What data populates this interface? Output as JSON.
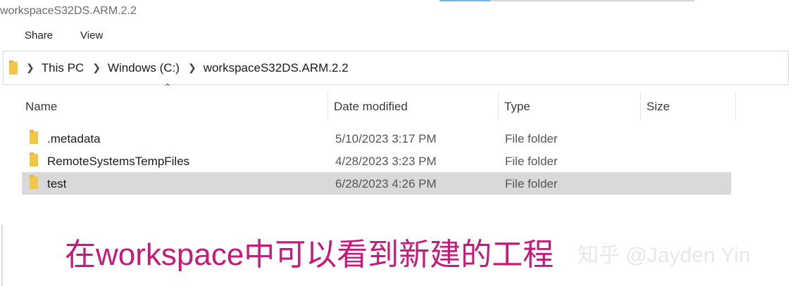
{
  "window": {
    "title": "workspaceS32DS.ARM.2.2"
  },
  "ribbon": {
    "tabs": [
      "Share",
      "View"
    ]
  },
  "address_bar": {
    "breadcrumbs": [
      "This PC",
      "Windows (C:)",
      "workspaceS32DS.ARM.2.2"
    ]
  },
  "columns": {
    "name": "Name",
    "date_modified": "Date modified",
    "type": "Type",
    "size": "Size"
  },
  "files": [
    {
      "name": ".metadata",
      "date_modified": "5/10/2023 3:17 PM",
      "type": "File folder",
      "size": "",
      "selected": false
    },
    {
      "name": "RemoteSystemsTempFiles",
      "date_modified": "4/28/2023 3:23 PM",
      "type": "File folder",
      "size": "",
      "selected": false
    },
    {
      "name": "test",
      "date_modified": "6/28/2023 4:26 PM",
      "type": "File folder",
      "size": "",
      "selected": true
    }
  ],
  "annotation": {
    "caption": "在workspace中可以看到新建的工程"
  },
  "watermark": {
    "text": "知乎 @Jayden Yin"
  },
  "icons": {
    "folder": "folder-icon",
    "breadcrumb_separator": "chevron-right-icon",
    "sort": "sort-up-icon"
  },
  "colors": {
    "folder": "#f3c64a",
    "selection": "#d9d9d9",
    "caption": "#c41b7b",
    "tab_accent": "#6fb6e6"
  }
}
